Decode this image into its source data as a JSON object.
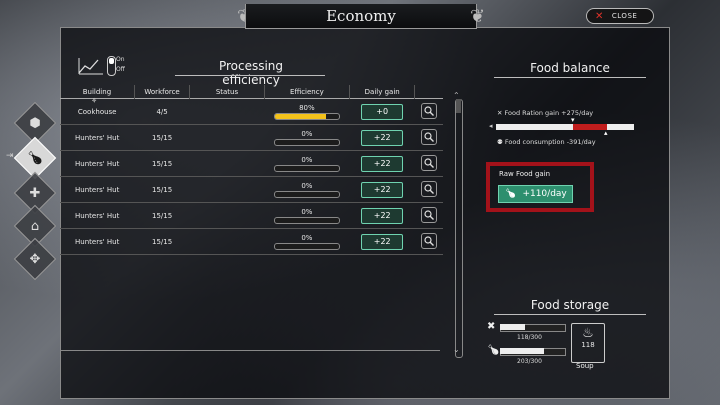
{
  "window": {
    "title": "Economy",
    "close_label": "CLOSE"
  },
  "tabs": [
    {
      "name": "resource-tab",
      "icon": "cube-icon",
      "active": false
    },
    {
      "name": "food-tab",
      "icon": "drumstick-icon",
      "active": true
    },
    {
      "name": "health-tab",
      "icon": "plus-icon",
      "active": false
    },
    {
      "name": "housing-tab",
      "icon": "house-icon",
      "active": false
    },
    {
      "name": "settings-tab",
      "icon": "cog-icon",
      "active": false
    }
  ],
  "processing": {
    "title": "Processing efficiency",
    "toggle_on": "On",
    "toggle_off": "Off",
    "columns": [
      "Building",
      "Workforce",
      "Status",
      "Efficiency",
      "Daily gain"
    ],
    "rows": [
      {
        "building": "Cookhouse",
        "workforce": "4/5",
        "status": "",
        "efficiency_label": "80%",
        "efficiency": 80,
        "gain": "+0"
      },
      {
        "building": "Hunters' Hut",
        "workforce": "15/15",
        "status": "",
        "efficiency_label": "0%",
        "efficiency": 0,
        "gain": "+22"
      },
      {
        "building": "Hunters' Hut",
        "workforce": "15/15",
        "status": "",
        "efficiency_label": "0%",
        "efficiency": 0,
        "gain": "+22"
      },
      {
        "building": "Hunters' Hut",
        "workforce": "15/15",
        "status": "",
        "efficiency_label": "0%",
        "efficiency": 0,
        "gain": "+22"
      },
      {
        "building": "Hunters' Hut",
        "workforce": "15/15",
        "status": "",
        "efficiency_label": "0%",
        "efficiency": 0,
        "gain": "+22"
      },
      {
        "building": "Hunters' Hut",
        "workforce": "15/15",
        "status": "",
        "efficiency_label": "0%",
        "efficiency": 0,
        "gain": "+22"
      }
    ]
  },
  "food_balance": {
    "title": "Food balance",
    "ration_label": "Food Ration gain +275/day",
    "consumption_label": "Food consumption -391/day",
    "raw_title": "Raw Food gain",
    "raw_value": "+110/day",
    "colors": {
      "deficit": "#c01d1d",
      "gain": "#2d8f6e",
      "highlight": "#a3121a"
    }
  },
  "food_storage": {
    "title": "Food storage",
    "rations": {
      "label": "118/300",
      "fill": 0.39
    },
    "raw": {
      "label": "203/300",
      "fill": 0.68
    },
    "soup": {
      "count": "118",
      "label": "Soup"
    }
  }
}
